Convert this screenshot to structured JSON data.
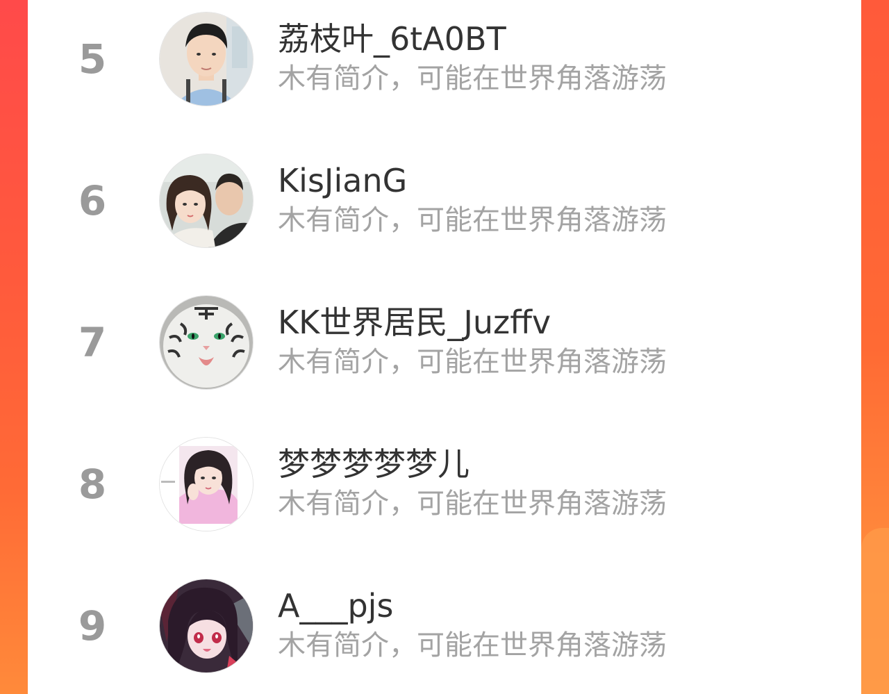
{
  "list": {
    "items": [
      {
        "rank": "5",
        "name": "荔枝叶_6tA0BT",
        "intro": "木有简介，可能在世界角落游荡",
        "avatar_icon": "avatar-young-man-icon"
      },
      {
        "rank": "6",
        "name": "KisJianG",
        "intro": "木有简介，可能在世界角落游荡",
        "avatar_icon": "avatar-couple-icon"
      },
      {
        "rank": "7",
        "name": "KK世界居民_Juzffv",
        "intro": "木有简介，可能在世界角落游荡",
        "avatar_icon": "avatar-white-tiger-icon"
      },
      {
        "rank": "8",
        "name": "梦梦梦梦梦儿",
        "intro": "木有简介，可能在世界角落游荡",
        "avatar_icon": "avatar-girl-pink-sweater-icon"
      },
      {
        "rank": "9",
        "name": "A___pjs",
        "intro": "木有简介，可能在世界角落游荡",
        "avatar_icon": "avatar-anime-girl-icon"
      }
    ]
  },
  "colors": {
    "background_gradient_top": "#ff4a4a",
    "background_gradient_bottom": "#ff8a3a",
    "card": "#ffffff",
    "rank_text": "#9a9a9a",
    "name_text": "#333333",
    "intro_text": "#a3a3a3"
  }
}
